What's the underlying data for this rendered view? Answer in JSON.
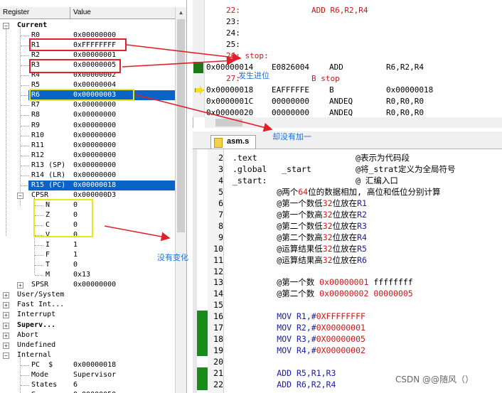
{
  "registers": {
    "header": {
      "name": "Register",
      "value": "Value"
    },
    "current_label": "Current",
    "rows": [
      {
        "name": "R0",
        "value": "0x00000000"
      },
      {
        "name": "R1",
        "value": "0xFFFFFFFF"
      },
      {
        "name": "R2",
        "value": "0x00000001"
      },
      {
        "name": "R3",
        "value": "0x00000005"
      },
      {
        "name": "R4",
        "value": "0x00000002"
      },
      {
        "name": "R5",
        "value": "0x00000004"
      },
      {
        "name": "R6",
        "value": "0x00000003"
      },
      {
        "name": "R7",
        "value": "0x00000000"
      },
      {
        "name": "R8",
        "value": "0x00000000"
      },
      {
        "name": "R9",
        "value": "0x00000000"
      },
      {
        "name": "R10",
        "value": "0x00000000"
      },
      {
        "name": "R11",
        "value": "0x00000000"
      },
      {
        "name": "R12",
        "value": "0x00000000"
      },
      {
        "name": "R13 (SP)",
        "value": "0x00000000"
      },
      {
        "name": "R14 (LR)",
        "value": "0x00000000"
      },
      {
        "name": "R15 (PC)",
        "value": "0x00000018"
      }
    ],
    "cpsr": {
      "name": "CPSR",
      "value": "0x000000D3"
    },
    "flags": [
      {
        "name": "N",
        "value": "0"
      },
      {
        "name": "Z",
        "value": "0"
      },
      {
        "name": "C",
        "value": "0"
      },
      {
        "name": "V",
        "value": "0"
      },
      {
        "name": "I",
        "value": "1"
      },
      {
        "name": "F",
        "value": "1"
      },
      {
        "name": "T",
        "value": "0"
      },
      {
        "name": "M",
        "value": "0x13"
      }
    ],
    "spsr": {
      "name": "SPSR",
      "value": "0x00000000"
    },
    "modes": [
      "User/System",
      "Fast Int...",
      "Interrupt",
      "Superv...",
      "Abort",
      "Undefined",
      "Internal"
    ],
    "internal": [
      {
        "name": "PC  $",
        "value": "0x00000018"
      },
      {
        "name": "Mode",
        "value": "Supervisor"
      },
      {
        "name": "States",
        "value": "6"
      },
      {
        "name": "S...",
        "value": "0.00000050"
      }
    ]
  },
  "disassembly": {
    "lines": [
      {
        "text": "22:",
        "op": "ADD R6,R2,R4",
        "red": true
      },
      {
        "text": "23:"
      },
      {
        "text": "24:"
      },
      {
        "text": "25:"
      },
      {
        "text": "26: stop:",
        "red": true
      },
      {
        "addr": "0x00000014",
        "code": "E0826004",
        "mn": "ADD",
        "ops": "R6,R2,R4"
      },
      {
        "text": "27:",
        "op": "B stop",
        "red": true
      },
      {
        "addr": "0x00000018",
        "code": "EAFFFFFE",
        "mn": "B",
        "ops": "0x00000018"
      },
      {
        "addr": "0x0000001C",
        "code": "00000000",
        "mn": "ANDEQ",
        "ops": "R0,R0,R0"
      },
      {
        "addr": "0x00000020",
        "code": "00000000",
        "mn": "ANDEQ",
        "ops": "R0,R0,R0"
      }
    ]
  },
  "source": {
    "tab": "asm.s",
    "lines": [
      {
        "n": "2",
        "parts": [
          {
            "t": ".text                    @表示为代码段",
            "c": "comment"
          }
        ]
      },
      {
        "n": "3",
        "parts": [
          {
            "t": ".global   _start         @将_strat定义为全局符号",
            "c": "comment"
          }
        ]
      },
      {
        "n": "4",
        "parts": [
          {
            "t": "_start:                  @ 汇编入口",
            "c": "comment"
          }
        ]
      },
      {
        "n": "5",
        "parts": [
          {
            "t": "         @两个",
            "c": "comment"
          },
          {
            "t": "64",
            "c": "red"
          },
          {
            "t": "位的数据相加, 高位和低位分别计算",
            "c": "comment"
          }
        ]
      },
      {
        "n": "6",
        "parts": [
          {
            "t": "         @第一个数低",
            "c": "comment"
          },
          {
            "t": "32",
            "c": "red"
          },
          {
            "t": "位放在",
            "c": "comment"
          },
          {
            "t": "R1",
            "c": "blue"
          }
        ]
      },
      {
        "n": "7",
        "parts": [
          {
            "t": "         @第一个数高",
            "c": "comment"
          },
          {
            "t": "32",
            "c": "red"
          },
          {
            "t": "位放在",
            "c": "comment"
          },
          {
            "t": "R2",
            "c": "blue"
          }
        ]
      },
      {
        "n": "8",
        "parts": [
          {
            "t": "         @第二个数低",
            "c": "comment"
          },
          {
            "t": "32",
            "c": "red"
          },
          {
            "t": "位放在",
            "c": "comment"
          },
          {
            "t": "R3",
            "c": "blue"
          }
        ]
      },
      {
        "n": "9",
        "parts": [
          {
            "t": "         @第二个数高",
            "c": "comment"
          },
          {
            "t": "32",
            "c": "red"
          },
          {
            "t": "位放在",
            "c": "comment"
          },
          {
            "t": "R4",
            "c": "blue"
          }
        ]
      },
      {
        "n": "10",
        "parts": [
          {
            "t": "         @运算结果低",
            "c": "comment"
          },
          {
            "t": "32",
            "c": "red"
          },
          {
            "t": "位放在",
            "c": "comment"
          },
          {
            "t": "R5",
            "c": "blue"
          }
        ]
      },
      {
        "n": "11",
        "parts": [
          {
            "t": "         @运算结果高",
            "c": "comment"
          },
          {
            "t": "32",
            "c": "red"
          },
          {
            "t": "位放在",
            "c": "comment"
          },
          {
            "t": "R6",
            "c": "blue"
          }
        ]
      },
      {
        "n": "12",
        "parts": []
      },
      {
        "n": "13",
        "parts": [
          {
            "t": "         @第一个数 ",
            "c": "comment"
          },
          {
            "t": "0x00000001",
            "c": "red"
          },
          {
            "t": " ffffffff",
            "c": "comment"
          }
        ]
      },
      {
        "n": "14",
        "parts": [
          {
            "t": "         @第二个数 ",
            "c": "comment"
          },
          {
            "t": "0x00000002 00000005",
            "c": "red"
          }
        ]
      },
      {
        "n": "15",
        "parts": []
      },
      {
        "n": "16",
        "parts": [
          {
            "t": "         MOV R1,#",
            "c": "blue"
          },
          {
            "t": "0XFFFFFFFF",
            "c": "red"
          }
        ]
      },
      {
        "n": "17",
        "parts": [
          {
            "t": "         MOV R2,#",
            "c": "blue"
          },
          {
            "t": "0X00000001",
            "c": "red"
          }
        ]
      },
      {
        "n": "18",
        "parts": [
          {
            "t": "         MOV R3,#",
            "c": "blue"
          },
          {
            "t": "0X00000005",
            "c": "red"
          }
        ]
      },
      {
        "n": "19",
        "parts": [
          {
            "t": "         MOV R4,#",
            "c": "blue"
          },
          {
            "t": "0X00000002",
            "c": "red"
          }
        ]
      },
      {
        "n": "20",
        "parts": []
      },
      {
        "n": "21",
        "parts": [
          {
            "t": "         ADD R5,R1,R3",
            "c": "blue"
          }
        ]
      },
      {
        "n": "22",
        "parts": [
          {
            "t": "         ADD R6,R2,R4",
            "c": "blue"
          }
        ]
      }
    ]
  },
  "annotations": {
    "carry": "发生进位",
    "not_incremented": "却没有加一",
    "no_change": "没有变化"
  },
  "watermark": "CSDN @@随风（）",
  "colors": {
    "highlight": "#0a64c8",
    "red_box": "#e0202a",
    "yellow_box": "#e8e81a",
    "annotation": "#1f6fd6",
    "arrow": "#e0202a",
    "exec_mark": "#1a7a1a"
  }
}
